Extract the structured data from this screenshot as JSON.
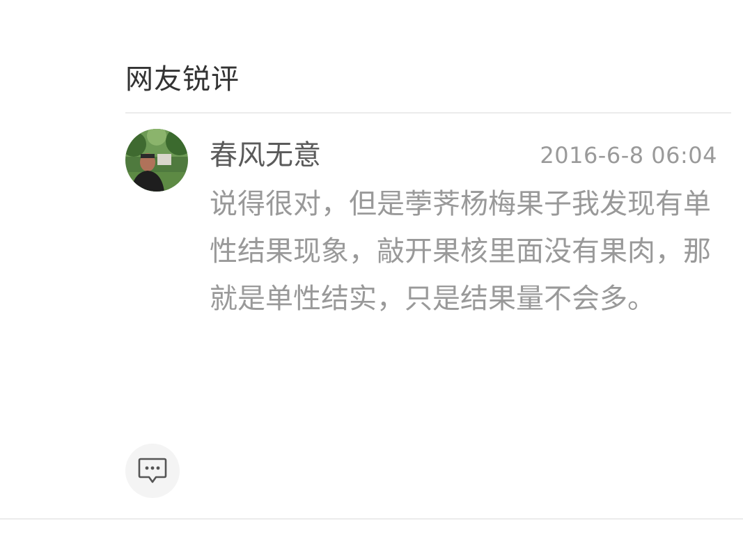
{
  "section": {
    "title": "网友锐评"
  },
  "comment": {
    "avatar_icon": "user-avatar-photo",
    "username": "春风无意",
    "timestamp": "2016-6-8 06:04",
    "text": "说得很对，但是荸荠杨梅果子我发现有单性结果现象，敲开果核里面没有果肉，那就是单性结实，只是结果量不会多。"
  },
  "actions": {
    "reply_icon": "comment-bubble-icon"
  },
  "colors": {
    "title": "#333333",
    "username": "#5a5a5a",
    "text": "#999999",
    "divider": "#ebebeb",
    "button_bg": "#f4f4f4"
  }
}
